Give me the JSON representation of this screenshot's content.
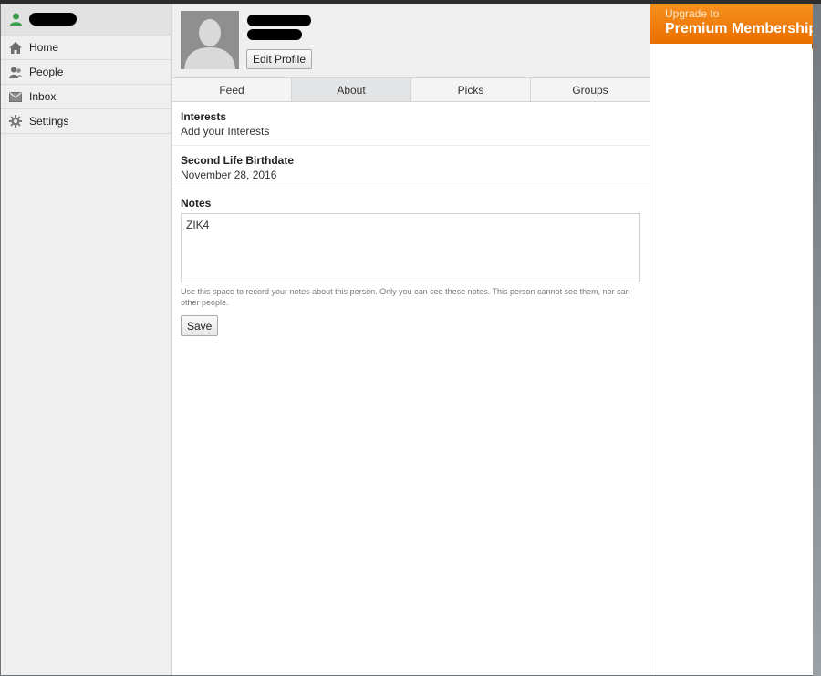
{
  "sidebar": {
    "items": [
      {
        "label": "Home"
      },
      {
        "label": "People"
      },
      {
        "label": "Inbox"
      },
      {
        "label": "Settings"
      }
    ]
  },
  "profile": {
    "edit_label": "Edit Profile"
  },
  "tabs": [
    {
      "label": "Feed"
    },
    {
      "label": "About",
      "active": true
    },
    {
      "label": "Picks"
    },
    {
      "label": "Groups"
    }
  ],
  "about": {
    "interests_title": "Interests",
    "interests_value": "Add your Interests",
    "birthdate_title": "Second Life Birthdate",
    "birthdate_value": "November 28, 2016",
    "notes_title": "Notes",
    "notes_value": "ZIK4",
    "notes_hint": "Use this space to record your notes about this person. Only you can see these notes. This person cannot see them, nor can other people.",
    "save_label": "Save"
  },
  "promo": {
    "line1": "Upgrade to",
    "line2": "Premium Membership"
  },
  "colors": {
    "promo_orange": "#f7901e",
    "user_icon_green": "#3aa04a"
  }
}
